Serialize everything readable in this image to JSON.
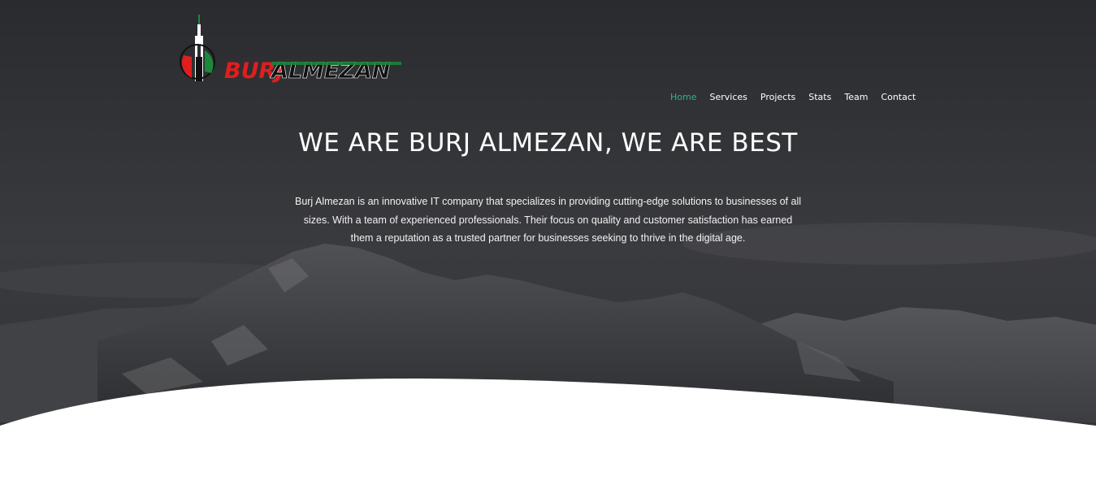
{
  "brand": {
    "logo_text_red": "BURJ",
    "logo_text_rest": "ALMEZAN",
    "colors": {
      "red": "#e01e1e",
      "green": "#1a8a3a",
      "black": "#111111",
      "white": "#ffffff"
    }
  },
  "nav": {
    "items": [
      {
        "label": "Home",
        "active": true
      },
      {
        "label": "Services",
        "active": false
      },
      {
        "label": "Projects",
        "active": false
      },
      {
        "label": "Stats",
        "active": false
      },
      {
        "label": "Team",
        "active": false
      },
      {
        "label": "Contact",
        "active": false
      }
    ],
    "active_color": "#2bb58e"
  },
  "hero": {
    "headline": "WE ARE BURJ ALMEZAN, WE ARE BEST",
    "intro": "Burj Almezan is an innovative IT company that specializes in providing cutting-edge solutions to businesses of all sizes. With a team of experienced professionals. Their focus on quality and customer satisfaction has earned them a reputation as a trusted partner for businesses seeking to thrive in the digital age."
  }
}
